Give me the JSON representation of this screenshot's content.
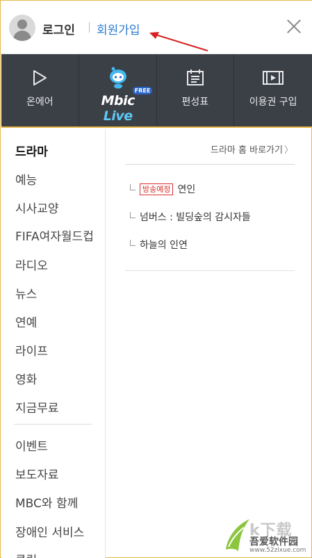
{
  "header": {
    "login_label": "로그인",
    "signup_label": "회원가입"
  },
  "nav": {
    "items": [
      {
        "label": "온에어",
        "icon": "play-icon"
      },
      {
        "label": "Mbic",
        "label2": "Live",
        "badge": "FREE",
        "icon": "mbic-mascot-icon"
      },
      {
        "label": "편성표",
        "icon": "schedule-icon"
      },
      {
        "label": "이용권 구입",
        "icon": "ticket-video-icon"
      }
    ]
  },
  "menu": {
    "items": [
      "드라마",
      "예능",
      "시사교양",
      "FIFA여자월드컵",
      "라디오",
      "뉴스",
      "연예",
      "라이프",
      "영화",
      "지금무료",
      "이벤트",
      "보도자료",
      "MBC와 함께",
      "장애인 서비스",
      "클립"
    ],
    "active": "드라마"
  },
  "content": {
    "home_link": "드라마 홈 바로가기",
    "programs": [
      {
        "badge": "방송예정",
        "title": "연인"
      },
      {
        "badge": "",
        "title": "넘버스 : 빌딩숲의 감시자들"
      },
      {
        "badge": "",
        "title": "하늘의 인연"
      }
    ]
  },
  "watermark": {
    "top": "k下载",
    "name": "吾爱软件园",
    "url": "www.52zixue.com"
  },
  "colors": {
    "accent_blue": "#2b7bd0",
    "nav_bg": "#3b3f46",
    "gold_border": "#e8b84a",
    "badge_red": "#d9302c",
    "arrow_red": "#d82020"
  }
}
